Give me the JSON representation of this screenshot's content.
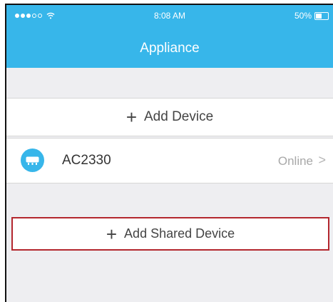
{
  "status_bar": {
    "time": "8:08 AM",
    "battery": "50%",
    "battery_level": 0.5
  },
  "header": {
    "title": "Appliance",
    "color": "#37b6ea"
  },
  "add_device": {
    "icon": "plus-icon",
    "label": "Add Device"
  },
  "devices": [
    {
      "name": "AC2330",
      "status": "Online",
      "icon": "air-conditioner-icon"
    }
  ],
  "add_shared_device": {
    "icon": "plus-icon",
    "label": "Add Shared Device",
    "highlight_color": "#b3272e"
  }
}
